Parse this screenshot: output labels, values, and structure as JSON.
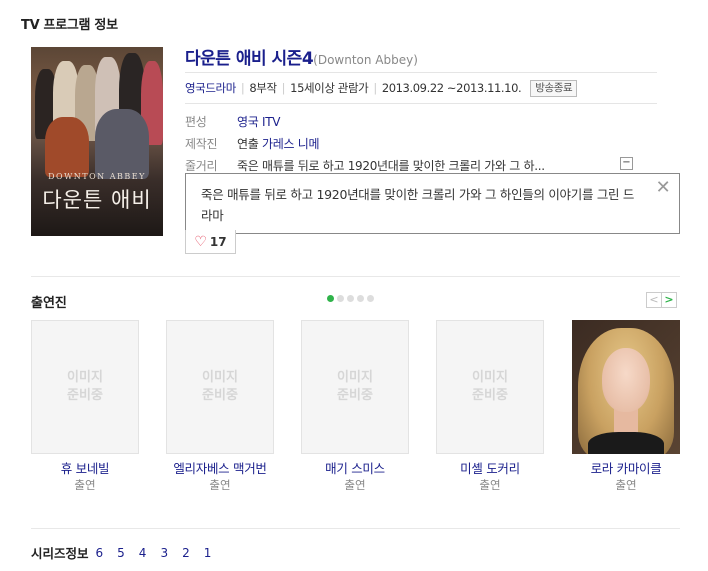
{
  "section_title": "TV 프로그램 정보",
  "poster": {
    "en_title": "DOWNTON ABBEY",
    "ko_title": "다운튼 애비"
  },
  "program": {
    "title": "다운튼 애비 시즌4",
    "original_title": "(Downton Abbey)",
    "genre": "영국드라마",
    "episodes": "8부작",
    "rating": "15세이상 관람가",
    "air_period": "2013.09.22 ~2013.11.10.",
    "status": "방송종료"
  },
  "info": {
    "channel_label": "편성",
    "channel_value": "영국 ITV",
    "production_label": "제작진",
    "production_role": "연출",
    "production_value": "가레스 니메",
    "synopsis_label": "줄거리",
    "synopsis_short": "죽은 매튜를 뒤로 하고 1920년대를 맞이한 크롤리 가와 그 하...",
    "toggle_symbol": "−"
  },
  "popup": {
    "text": "죽은 매튜를 뒤로 하고 1920년대를 맞이한 크롤리 가와 그 하인들의 이야기를 그린 드라마",
    "close_symbol": "✕"
  },
  "like": {
    "heart": "♡",
    "count": "17"
  },
  "cast_section": {
    "title": "출연진",
    "page_count": 5,
    "active_page": 1,
    "prev_symbol": "<",
    "next_symbol": ">",
    "placeholder_line1": "이미지",
    "placeholder_line2": "준비중",
    "members": [
      {
        "name": "휴 보네빌",
        "role": "출연"
      },
      {
        "name": "엘리자베스 맥거번",
        "role": "출연"
      },
      {
        "name": "매기 스미스",
        "role": "출연"
      },
      {
        "name": "미셸 도커리",
        "role": "출연"
      },
      {
        "name": "로라 카마이클",
        "role": "출연"
      }
    ]
  },
  "series": {
    "label": "시리즈정보",
    "seasons": [
      "6",
      "5",
      "4",
      "3",
      "2",
      "1"
    ]
  }
}
